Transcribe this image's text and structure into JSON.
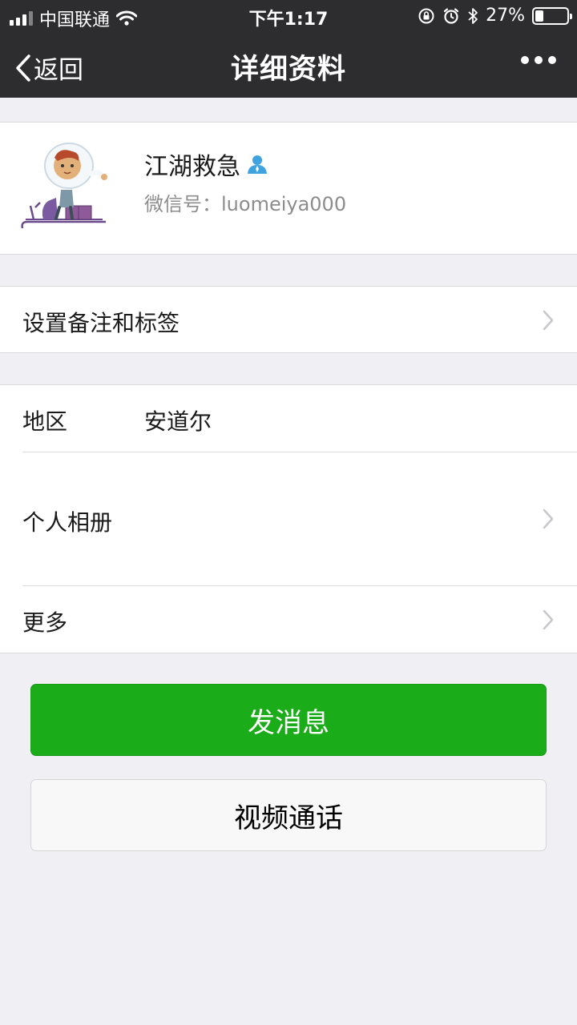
{
  "status_bar": {
    "carrier": "中国联通",
    "time": "下午1:17",
    "battery_text": "27%",
    "battery_level": 0.27,
    "icons": [
      "signal-icon",
      "wifi-icon",
      "rotation-lock-icon",
      "alarm-icon",
      "bluetooth-icon",
      "battery-icon"
    ]
  },
  "nav": {
    "back_label": "返回",
    "title": "详细资料"
  },
  "profile": {
    "nickname": "江湖救急",
    "wechat_id_label": "微信号：",
    "wechat_id": "luomeiya000"
  },
  "rows": {
    "remark_label": "设置备注和标签",
    "region_label": "地区",
    "region_value": "安道尔",
    "album_label": "个人相册",
    "more_label": "更多"
  },
  "actions": {
    "send_message": "发消息",
    "video_call": "视频通话"
  },
  "colors": {
    "nav_bg": "#2d2d30",
    "page_bg": "#efeff4",
    "primary_green": "#1aad19",
    "contact_badge_blue": "#3fa3e0"
  }
}
